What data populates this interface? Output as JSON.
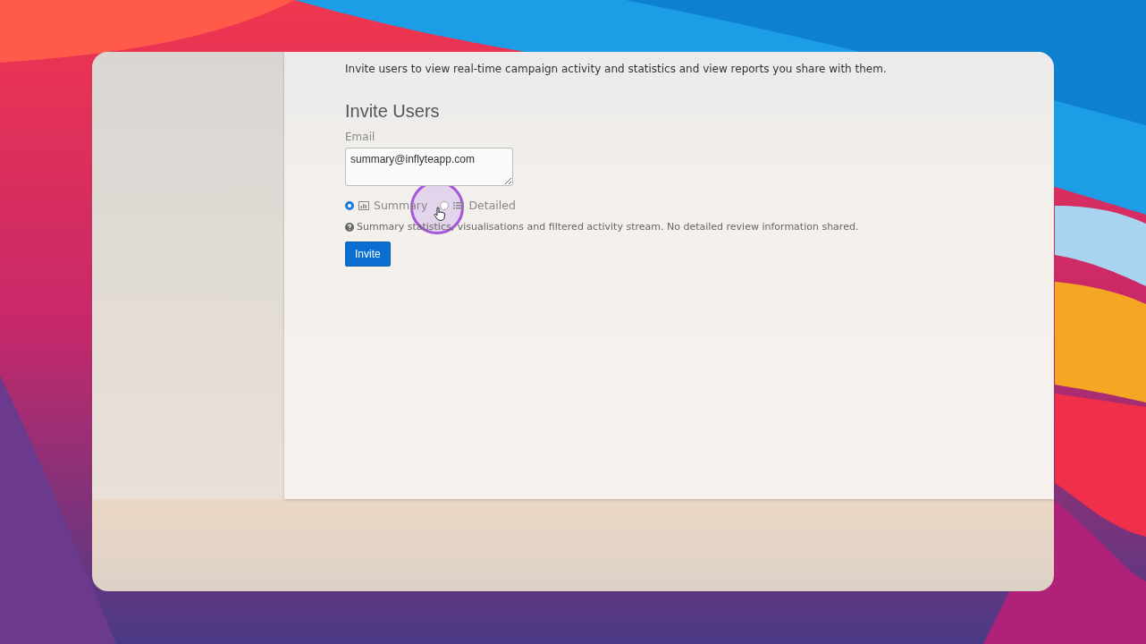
{
  "intro": "Invite users to view real-time campaign activity and statistics and view reports you share with them.",
  "heading": "Invite Users",
  "email": {
    "label": "Email",
    "value": "summary@inflyteapp.com"
  },
  "access_options": [
    {
      "label": "Summary",
      "kind": "chart",
      "selected": true
    },
    {
      "label": "Detailed",
      "kind": "list",
      "selected": false
    }
  ],
  "help_text": "Summary statistics, visualisations and filtered activity stream. No detailed review information shared.",
  "invite_button": "Invite"
}
